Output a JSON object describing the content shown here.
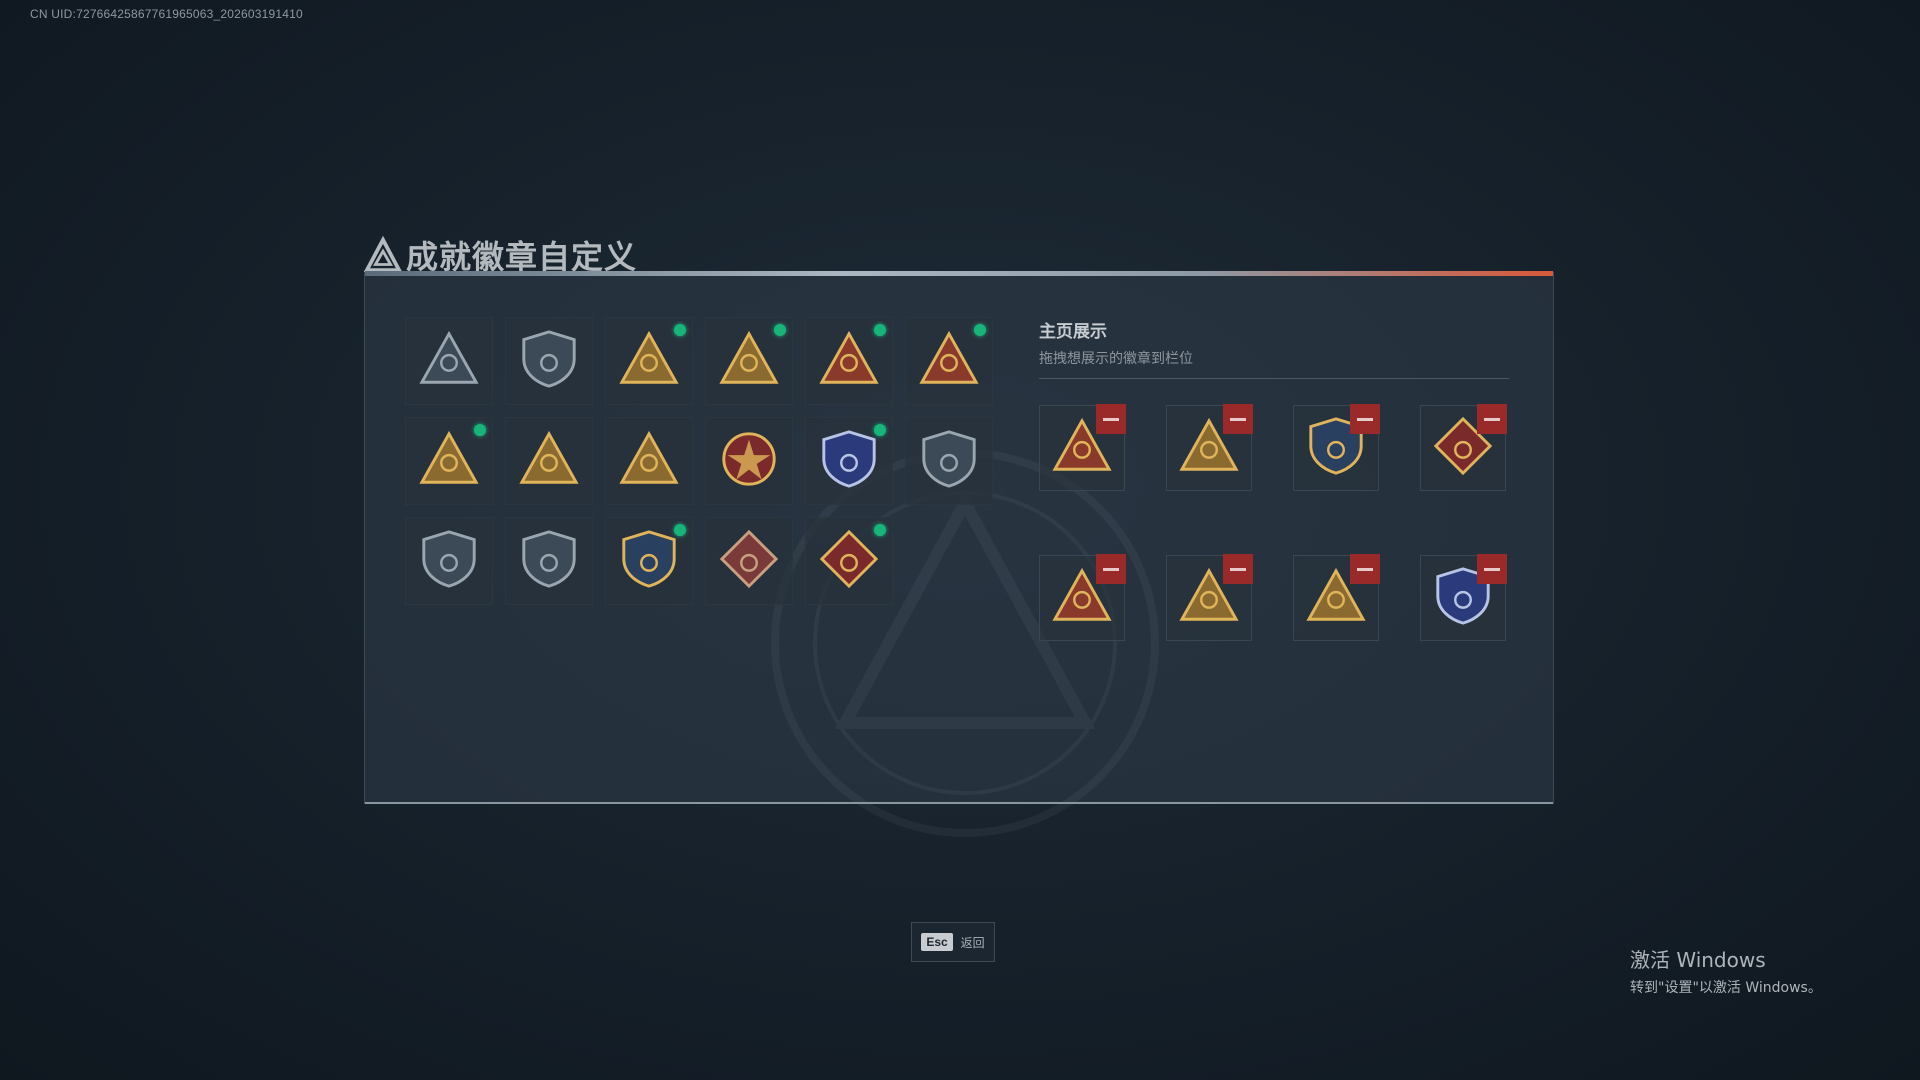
{
  "uid_text": "CN UID:72766425867761965063_202603191410",
  "page": {
    "title": "成就徽章自定义"
  },
  "badges": [
    {
      "icon": "shield-triangle-icon",
      "color": "#3c4a57",
      "accent": "#9aa6b0",
      "new": false
    },
    {
      "icon": "helicopter-shield-icon",
      "color": "#3c4a57",
      "accent": "#9aa6b0",
      "new": false
    },
    {
      "icon": "hourglass-triangle-icon",
      "color": "#8a6a2e",
      "accent": "#e0b45a",
      "new": true
    },
    {
      "icon": "boat-triangle-icon",
      "color": "#8a6a2e",
      "accent": "#e0b45a",
      "new": true
    },
    {
      "icon": "number-one-triangle-icon",
      "color": "#8a3a2a",
      "accent": "#e0b45a",
      "new": true
    },
    {
      "icon": "backpack-triangle-icon",
      "color": "#8a3a2a",
      "accent": "#e0b45a",
      "new": true
    },
    {
      "icon": "soldier-triangle-icon",
      "color": "#8a6a2e",
      "accent": "#e0b45a",
      "new": true
    },
    {
      "icon": "squad-triangle-icon",
      "color": "#8a6a2e",
      "accent": "#e0b45a",
      "new": false
    },
    {
      "icon": "rocket-triangle-icon",
      "color": "#8a6a2e",
      "accent": "#e0b45a",
      "new": false
    },
    {
      "icon": "star-compass-badge-icon",
      "color": "#7a2a2a",
      "accent": "#e0b45a",
      "new": false
    },
    {
      "icon": "police-shield-icon",
      "color": "#2a3a7a",
      "accent": "#b8c4e6",
      "new": true
    },
    {
      "icon": "wolf-shield-icon",
      "color": "#3c4a57",
      "accent": "#9aa6b0",
      "new": false
    },
    {
      "icon": "no-weapon-shield-icon",
      "color": "#3c4a57",
      "accent": "#9aa6b0",
      "new": false
    },
    {
      "icon": "no-weapon-shield-icon",
      "color": "#3c4a57",
      "accent": "#9aa6b0",
      "new": false
    },
    {
      "icon": "crest-shield-icon",
      "color": "#2a4060",
      "accent": "#e0b45a",
      "new": true
    },
    {
      "icon": "tiger-diamond-icon",
      "color": "#7a3a3a",
      "accent": "#c8a080",
      "new": false
    },
    {
      "icon": "dragon-diamond-icon",
      "color": "#7a2a2a",
      "accent": "#e0b45a",
      "new": true
    }
  ],
  "showcase": {
    "title": "主页展示",
    "subtitle": "拖拽想展示的徽章到栏位",
    "slots": [
      {
        "icon": "backpack-triangle-icon",
        "color": "#8a3a2a",
        "accent": "#e0b45a"
      },
      {
        "icon": "soldier-triangle-icon",
        "color": "#8a6a2e",
        "accent": "#e0b45a"
      },
      {
        "icon": "crest-shield-icon",
        "color": "#2a4060",
        "accent": "#e0b45a"
      },
      {
        "icon": "dragon-diamond-icon",
        "color": "#7a2a2a",
        "accent": "#e0b45a"
      },
      {
        "icon": "number-one-triangle-icon",
        "color": "#8a3a2a",
        "accent": "#e0b45a"
      },
      {
        "icon": "boat-triangle-icon",
        "color": "#8a6a2e",
        "accent": "#e0b45a"
      },
      {
        "icon": "hourglass-triangle-icon",
        "color": "#8a6a2e",
        "accent": "#e0b45a"
      },
      {
        "icon": "police-shield-icon",
        "color": "#2a3a7a",
        "accent": "#b8c4e6"
      }
    ]
  },
  "footer": {
    "esc_key": "Esc",
    "esc_label": "返回"
  },
  "windows_activation": {
    "line1": "激活 Windows",
    "line2": "转到\"设置\"以激活 Windows。"
  }
}
